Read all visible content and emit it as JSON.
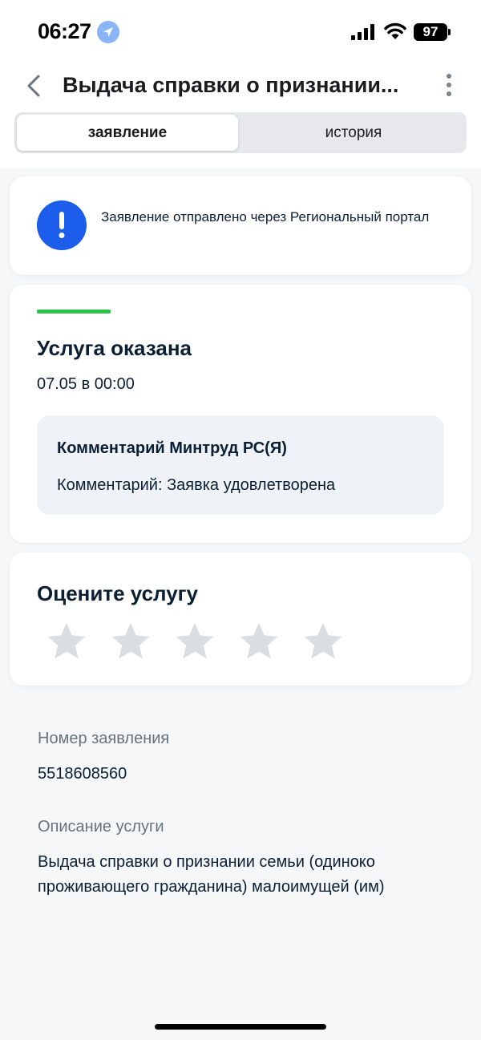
{
  "status_bar": {
    "time": "06:27",
    "battery": "97",
    "icons": [
      "location-arrow-icon",
      "cellular-signal-icon",
      "wifi-icon",
      "battery-icon"
    ]
  },
  "header": {
    "title": "Выдача справки о признании...",
    "back_icon": "chevron-left-icon",
    "more_icon": "vertical-dots-icon"
  },
  "tabs": [
    {
      "label": "заявление",
      "active": true
    },
    {
      "label": "история",
      "active": false
    }
  ],
  "info_notice": {
    "icon": "exclamation-icon",
    "text": "Заявление отправлено через Региональный портал"
  },
  "status": {
    "indicator_color": "#2bc04a",
    "title": "Услуга оказана",
    "date": "07.05 в 00:00",
    "comment_title": "Комментарий Минтруд РС(Я)",
    "comment_text": "Комментарий: Заявка удовлетворена"
  },
  "rating": {
    "title": "Оцените услугу",
    "max": 5,
    "value": 0
  },
  "details": {
    "number_label": "Номер заявления",
    "number_value": "5518608560",
    "description_label": "Описание услуги",
    "description_value": "Выдача справки о признании семьи (одиноко проживающего гражданина) малоимущей (им)"
  },
  "colors": {
    "accent": "#1d5deb",
    "success": "#2bc04a",
    "star_inactive": "#dadde1"
  }
}
